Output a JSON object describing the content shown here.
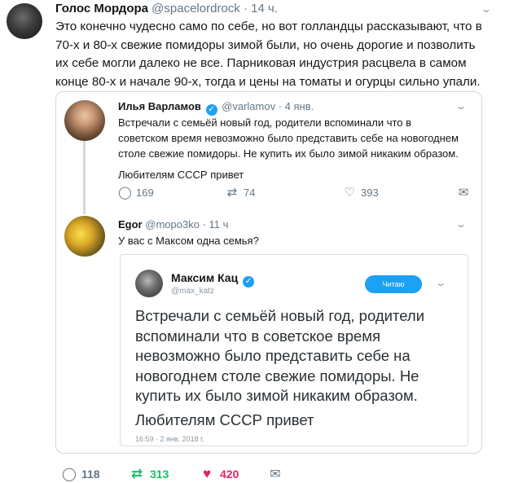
{
  "tweet": {
    "author_name": "Голос Мордора",
    "author_handle": "@spacelordrock",
    "time": "· 14 ч.",
    "text": "Это конечно чудесно само по себе, но вот голландцы рассказывают, что в 70-х и 80-х свежие помидоры зимой были, но очень дорогие и позволить их себе могли далеко не все. Парниковая индустрия расцвела в самом конце 80-х и начале 90-х, тогда и цены на томаты и огурцы сильно упали.",
    "stats": {
      "replies": "118",
      "retweets": "313",
      "likes": "420"
    }
  },
  "quoted": {
    "varlamov": {
      "name": "Илья Варламов",
      "handle": "@varlamov",
      "time": "· 4 янв.",
      "text": "Встречали с семьёй новый год, родители вспоминали что в советском время невозможно было представить себе на новогоднем столе свежие помидоры. Не купить их было зимой никаким образом.",
      "text2": "Любителям СССР привет",
      "stats": {
        "replies": "169",
        "retweets": "74",
        "likes": "393"
      }
    },
    "egor": {
      "name": "Egor",
      "handle": "@moро3ko",
      "time": "· 11 ч",
      "text": "У вас с Максом одна семья?"
    },
    "katz": {
      "name": "Максим Кац",
      "handle": "@max_katz",
      "follow_label": "Читаю",
      "text": "Встречали с семьёй новый год, родители вспоминали что в советское время невозможно было представить себе на новогоднем столе свежие помидоры. Не купить их было зимой никаким образом.",
      "text2": "Любителям СССР привет",
      "date": "16:59 · 2 янв. 2018 г."
    }
  },
  "icons": {
    "reply": "speech-bubble",
    "retweet": "retweet-arrows",
    "like": "heart",
    "dm": "envelope",
    "menu": "chevron-down"
  },
  "colors": {
    "like": "#e0245e",
    "retweet": "#17bf63",
    "link": "#1da1f2"
  }
}
